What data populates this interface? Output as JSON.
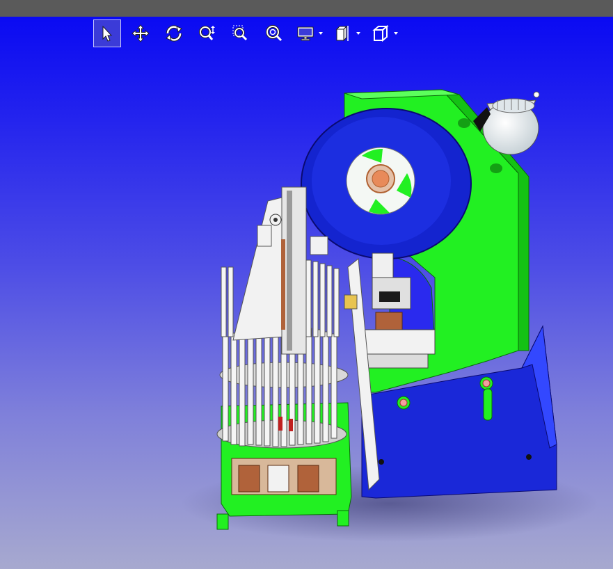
{
  "window": {
    "title_bar_color": "#5a5a5a"
  },
  "viewport": {
    "background_top": "#0a0af2",
    "background_bottom": "#a7a9cf",
    "model_colors": {
      "frame_green": "#22f022",
      "base_blue": "#1a28d8",
      "tooling_white": "#f2f2f2",
      "copper": "#b0623a"
    }
  },
  "toolbar": {
    "tools": [
      {
        "icon": "select-arrow-icon",
        "selected": true
      },
      {
        "icon": "pan-move-icon",
        "selected": false
      },
      {
        "icon": "rotate-icon",
        "selected": false
      },
      {
        "icon": "zoom-icon",
        "selected": false
      },
      {
        "icon": "zoom-window-icon",
        "selected": false
      },
      {
        "icon": "zoom-fit-icon",
        "selected": false
      },
      {
        "icon": "display-mode-icon",
        "has_dropdown": true
      },
      {
        "icon": "section-view-icon",
        "has_dropdown": true
      },
      {
        "icon": "view-cube-icon",
        "has_dropdown": true
      }
    ]
  }
}
